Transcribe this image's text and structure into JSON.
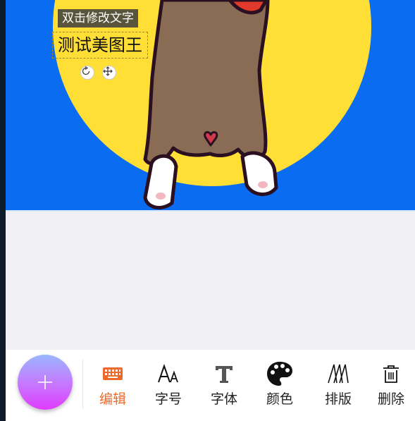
{
  "canvas": {
    "hint_text": "双击修改文字",
    "text_content": "测试美图王"
  },
  "handles": {
    "rotate_icon": "rotate-icon",
    "move_icon": "move-icon"
  },
  "fab": {
    "icon": "plus-icon"
  },
  "toolbar": {
    "items": [
      {
        "label": "编辑",
        "icon": "keyboard-icon",
        "active": true
      },
      {
        "label": "字号",
        "icon": "font-size-icon",
        "active": false
      },
      {
        "label": "字体",
        "icon": "font-type-icon",
        "active": false
      },
      {
        "label": "颜色",
        "icon": "palette-icon",
        "active": false
      },
      {
        "label": "排版",
        "icon": "layout-icon",
        "active": false
      },
      {
        "label": "删除",
        "icon": "trash-icon",
        "active": false
      }
    ]
  },
  "colors": {
    "canvas_background": "#0a6cf0",
    "sun": "#ffde36",
    "accent": "#ee6a2b",
    "dog_body": "#8a6c55",
    "collar": "#e23a2a"
  }
}
